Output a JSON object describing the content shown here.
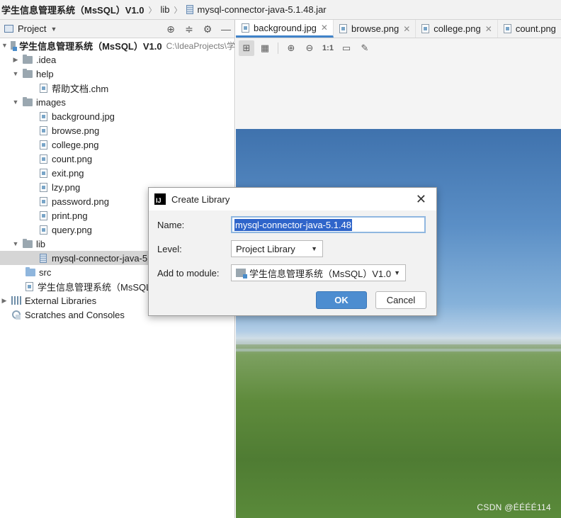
{
  "breadcrumb": {
    "project": "学生信息管理系统（MsSQL）V1.0",
    "folder": "lib",
    "file": "mysql-connector-java-5.1.48.jar"
  },
  "project_panel": {
    "title": "Project",
    "tools": [
      "locate-icon",
      "collapse-icon",
      "gear-icon",
      "minimize-icon"
    ]
  },
  "tree": {
    "root": {
      "label": "学生信息管理系统（MsSQL）V1.0",
      "path": "C:\\IdeaProjects\\学"
    },
    "idea": ".idea",
    "help": "help",
    "help_file": "帮助文档.chm",
    "images": "images",
    "image_files": [
      "background.jpg",
      "browse.png",
      "college.png",
      "count.png",
      "exit.png",
      "lzy.png",
      "password.png",
      "print.png",
      "query.png"
    ],
    "lib": "lib",
    "lib_file": "mysql-connector-java-5",
    "src": "src",
    "iml": "学生信息管理系统（MsSQL）",
    "external": "External Libraries",
    "scratches": "Scratches and Consoles"
  },
  "tabs": [
    {
      "label": "background.jpg",
      "active": true
    },
    {
      "label": "browse.png",
      "active": false
    },
    {
      "label": "college.png",
      "active": false
    },
    {
      "label": "count.png",
      "active": false
    }
  ],
  "image_toolbar": {
    "actual_size": "1:1",
    "buttons": [
      "grid-icon",
      "chessboard-icon",
      "zoom-in-icon",
      "zoom-out-icon",
      "actual-size",
      "fit-icon",
      "color-picker-icon"
    ]
  },
  "dialog": {
    "title": "Create Library",
    "name_label": "Name:",
    "name_value": "mysql-connector-java-5.1.48",
    "level_label": "Level:",
    "level_value": "Project Library",
    "module_label": "Add to module:",
    "module_value": "学生信息管理系统（MsSQL）V1.0",
    "ok": "OK",
    "cancel": "Cancel"
  },
  "watermark": "CSDN @ÉÉÉÉ114"
}
